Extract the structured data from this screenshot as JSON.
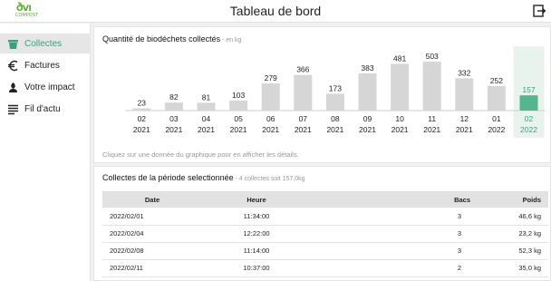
{
  "header": {
    "logo_text": "OVI",
    "logo_sub": "COMPOST",
    "title": "Tableau de bord",
    "logout_icon": "logout-icon"
  },
  "sidebar": {
    "items": [
      {
        "label": "Collectes",
        "icon": "bin-icon",
        "active": true
      },
      {
        "label": "Factures",
        "icon": "euro-icon",
        "active": false
      },
      {
        "label": "Votre impact",
        "icon": "plant-icon",
        "active": false
      },
      {
        "label": "Fil d'actu",
        "icon": "list-icon",
        "active": false
      }
    ]
  },
  "colors": {
    "accent": "#3aa17e",
    "bar_default": "#d6d6d6",
    "bar_selected": "#55b58e",
    "selected_bg": "#e8f3ee"
  },
  "chart_section": {
    "title": "Quantité de biodéchets collectés",
    "subtitle": " - en kg",
    "hint": "Cliquez sur une donnée du graphique pour en afficher les détails."
  },
  "chart_data": {
    "type": "bar",
    "categories": [
      [
        "02",
        "2021"
      ],
      [
        "03",
        "2021"
      ],
      [
        "04",
        "2021"
      ],
      [
        "05",
        "2021"
      ],
      [
        "06",
        "2021"
      ],
      [
        "07",
        "2021"
      ],
      [
        "08",
        "2021"
      ],
      [
        "09",
        "2021"
      ],
      [
        "10",
        "2021"
      ],
      [
        "11",
        "2021"
      ],
      [
        "12",
        "2021"
      ],
      [
        "01",
        "2022"
      ],
      [
        "02",
        "2022"
      ]
    ],
    "values": [
      23,
      82,
      81,
      103,
      279,
      366,
      173,
      383,
      481,
      503,
      332,
      252,
      157
    ],
    "selected_index": 12,
    "ylim": [
      0,
      503
    ]
  },
  "table_section": {
    "title": "Collectes de la période selectionnée",
    "subtitle": " - 4 collectes soit 157,0kg",
    "columns": {
      "date": "Date",
      "heure": "Heure",
      "bacs": "Bacs",
      "poids": "Poids"
    },
    "rows": [
      {
        "date": "2022/02/01",
        "heure": "11:34:00",
        "bacs": "3",
        "poids": "46,6 kg"
      },
      {
        "date": "2022/02/04",
        "heure": "12:22:00",
        "bacs": "3",
        "poids": "23,2 kg"
      },
      {
        "date": "2022/02/08",
        "heure": "11:14:00",
        "bacs": "3",
        "poids": "52,3 kg"
      },
      {
        "date": "2022/02/11",
        "heure": "10:37:00",
        "bacs": "2",
        "poids": "35,0 kg"
      }
    ]
  }
}
